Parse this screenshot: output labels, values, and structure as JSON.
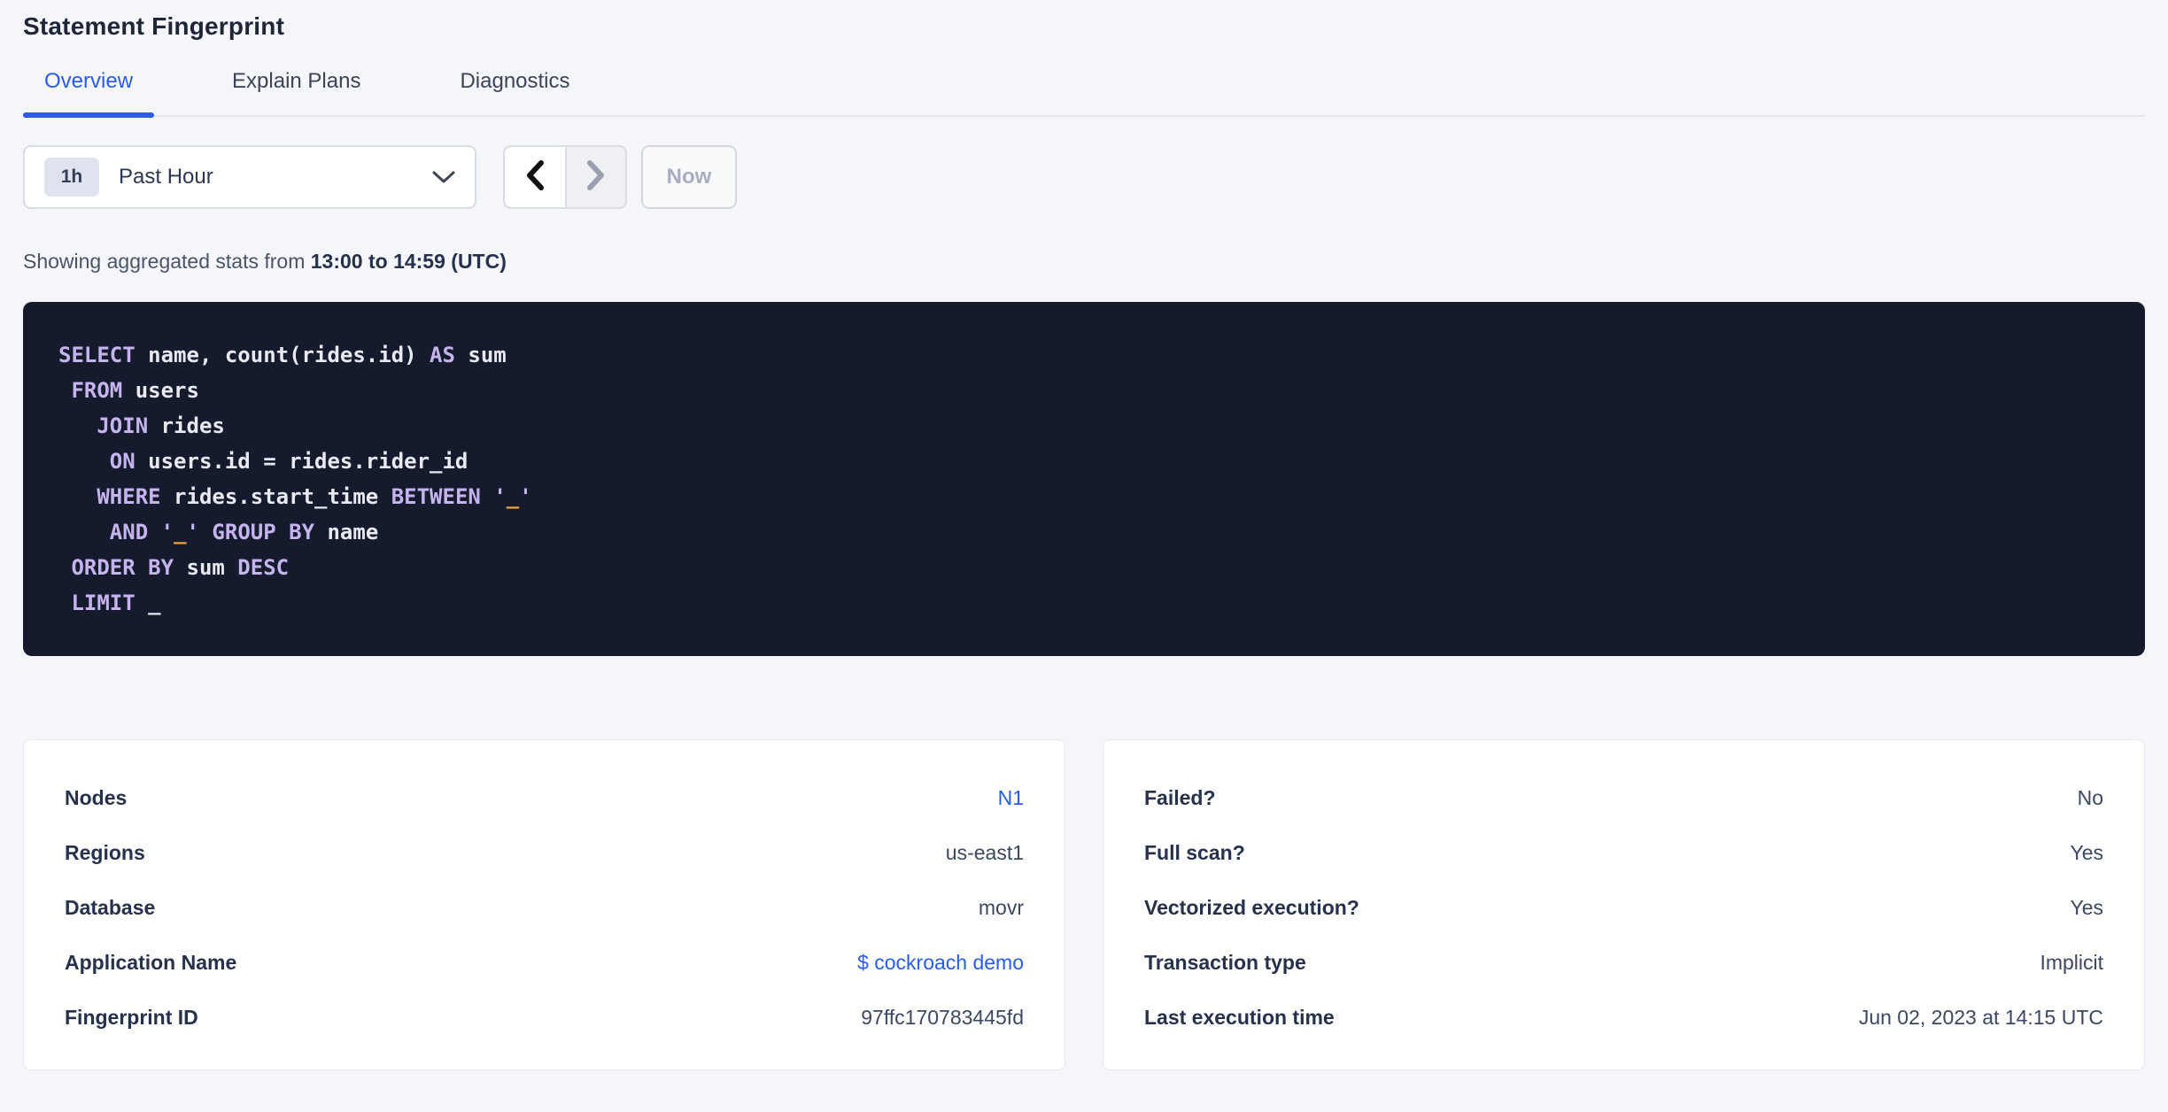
{
  "page": {
    "title": "Statement Fingerprint"
  },
  "tabs": [
    {
      "label": "Overview",
      "active": true
    },
    {
      "label": "Explain Plans",
      "active": false
    },
    {
      "label": "Diagnostics",
      "active": false
    }
  ],
  "time_picker": {
    "badge": "1h",
    "label": "Past Hour",
    "dropdown_icon": "chevron-down-icon",
    "prev_icon": "chevron-left-icon",
    "next_icon": "chevron-right-icon",
    "now_label": "Now"
  },
  "caption": {
    "prefix": "Showing aggregated stats from ",
    "range": "13:00 to 14:59 (UTC)"
  },
  "sql": {
    "lines": [
      [
        {
          "c": "kw",
          "t": "SELECT"
        },
        {
          "c": "pl",
          "t": " name, count(rides.id) "
        },
        {
          "c": "kw",
          "t": "AS"
        },
        {
          "c": "pl",
          "t": " sum"
        }
      ],
      [
        {
          "c": "pl",
          "t": " "
        },
        {
          "c": "kw",
          "t": "FROM"
        },
        {
          "c": "pl",
          "t": " users"
        }
      ],
      [
        {
          "c": "pl",
          "t": "   "
        },
        {
          "c": "kw",
          "t": "JOIN"
        },
        {
          "c": "pl",
          "t": " rides"
        }
      ],
      [
        {
          "c": "pl",
          "t": "    "
        },
        {
          "c": "kw",
          "t": "ON"
        },
        {
          "c": "pl",
          "t": " users.id = rides.rider_id"
        }
      ],
      [
        {
          "c": "pl",
          "t": "   "
        },
        {
          "c": "kw",
          "t": "WHERE"
        },
        {
          "c": "pl",
          "t": " rides.start_time "
        },
        {
          "c": "kw",
          "t": "BETWEEN"
        },
        {
          "c": "pl",
          "t": " "
        },
        {
          "c": "kw",
          "t": "'"
        },
        {
          "c": "lit",
          "t": "_"
        },
        {
          "c": "kw",
          "t": "'"
        }
      ],
      [
        {
          "c": "pl",
          "t": "    "
        },
        {
          "c": "kw",
          "t": "AND"
        },
        {
          "c": "pl",
          "t": " "
        },
        {
          "c": "kw",
          "t": "'"
        },
        {
          "c": "lit",
          "t": "_"
        },
        {
          "c": "kw",
          "t": "'"
        },
        {
          "c": "pl",
          "t": " "
        },
        {
          "c": "kw",
          "t": "GROUP BY"
        },
        {
          "c": "pl",
          "t": " name"
        }
      ],
      [
        {
          "c": "pl",
          "t": " "
        },
        {
          "c": "kw",
          "t": "ORDER BY"
        },
        {
          "c": "pl",
          "t": " sum "
        },
        {
          "c": "kw",
          "t": "DESC"
        }
      ],
      [
        {
          "c": "pl",
          "t": " "
        },
        {
          "c": "kw",
          "t": "LIMIT"
        },
        {
          "c": "pl",
          "t": " _"
        }
      ]
    ]
  },
  "cards": {
    "left": {
      "rows": [
        {
          "label": "Nodes",
          "value": "N1"
        },
        {
          "label": "Regions",
          "value": "us-east1"
        },
        {
          "label": "Database",
          "value": "movr"
        },
        {
          "label": "Application Name",
          "value": "$ cockroach demo"
        },
        {
          "label": "Fingerprint ID",
          "value": "97ffc170783445fd"
        }
      ]
    },
    "right": {
      "rows": [
        {
          "label": "Failed?",
          "value": "No"
        },
        {
          "label": "Full scan?",
          "value": "Yes"
        },
        {
          "label": "Vectorized execution?",
          "value": "Yes"
        },
        {
          "label": "Transaction type",
          "value": "Implicit"
        },
        {
          "label": "Last execution time",
          "value": "Jun 02, 2023 at 14:15 UTC"
        }
      ]
    }
  },
  "colors": {
    "accent": "#2a5ce8",
    "bg": "#f4f6fa",
    "sqlBg": "#151a2d",
    "sqlKeyword": "#c5b4ee",
    "sqlPlain": "#e7eaf1",
    "sqlLiteral": "#eba33f"
  }
}
